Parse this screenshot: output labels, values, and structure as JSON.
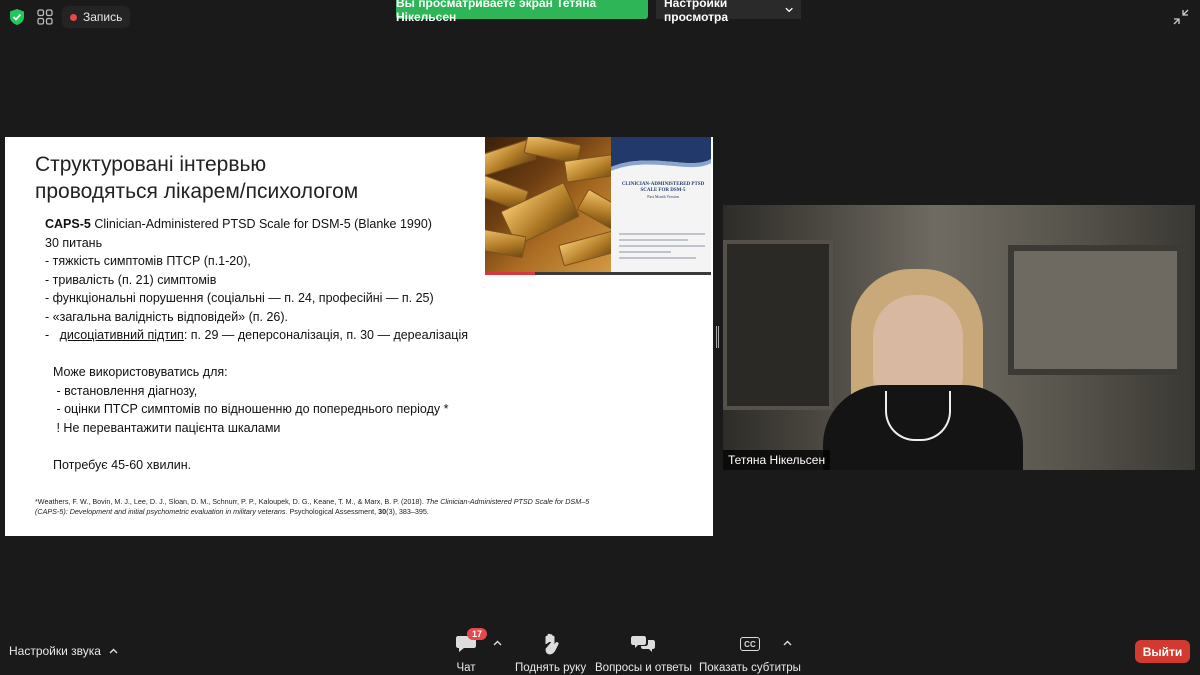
{
  "top_bar": {
    "record_label": "Запись",
    "share_banner": "Вы просматриваете экран Тетяна Нікельсен",
    "view_options_label": "Настройки просмотра"
  },
  "slide": {
    "title_line1": "Структуровані інтервью",
    "title_line2": "проводяться лікарем/психологом",
    "caps_bold": "CAPS-5",
    "caps_rest": " Clinician-Administered PTSD Scale for DSM-5 (Blanke 1990)",
    "items_count": " 30 питань",
    "bullets": [
      "-   тяжкість симптомів ПТСР (п.1-20),",
      "-   тривалість (п. 21) симптомів",
      "-   функціональні порушення (соціальні — п. 24, професійні — п. 25)",
      "-   «загальна валідність відповідей» (п. 26)."
    ],
    "dissoc_prefix": "-   ",
    "dissoc_underlined": "дисоціативний підтип",
    "dissoc_rest": ": п. 29 — деперсоналізація, п. 30 — дереалізація",
    "usage_heading": "Може використовуватись для:",
    "usage_items": [
      " - встановлення діагнозу,",
      " - оцінки ПТСР симптомів по відношенню до попереднього періоду *",
      " ! Не перевантажити пацієнта шкалами"
    ],
    "duration": "Потребує 45-60 хвилин.",
    "reference_plain": "*Weathers, F. W., Bovin, M. J., Lee, D. J., Sloan, D. M., Schnurr, P. P., Kaloupek, D. G., Keane, T. M., & Marx, B. P. (2018). ",
    "reference_italic": "The Clinician-Administered PTSD Scale for DSM–5 (CAPS-5): Development and initial psychometric evaluation in military veterans.",
    "reference_journal": " Psychological Assessment, ",
    "reference_volume": "30",
    "reference_pages": "(3), 383–395.",
    "doc_cover_title": "CLINICIAN-ADMINISTERED PTSD SCALE FOR DSM-5",
    "doc_cover_subtitle": "Past Month Version",
    "progress_fraction": 0.22
  },
  "video": {
    "participant_name": "Тетяна Нікельсен"
  },
  "bottom_bar": {
    "audio_settings": "Настройки звука",
    "chat_label": "Чат",
    "chat_badge": "17",
    "raise_hand_label": "Поднять руку",
    "qa_label": "Вопросы и ответы",
    "captions_label": "Показать субтитры",
    "captions_icon_text": "CC",
    "leave_label": "Выйти"
  },
  "colors": {
    "share_banner": "#2db558",
    "leave_button": "#d33a2f",
    "badge": "#e5484d",
    "shield": "#22c55e"
  }
}
